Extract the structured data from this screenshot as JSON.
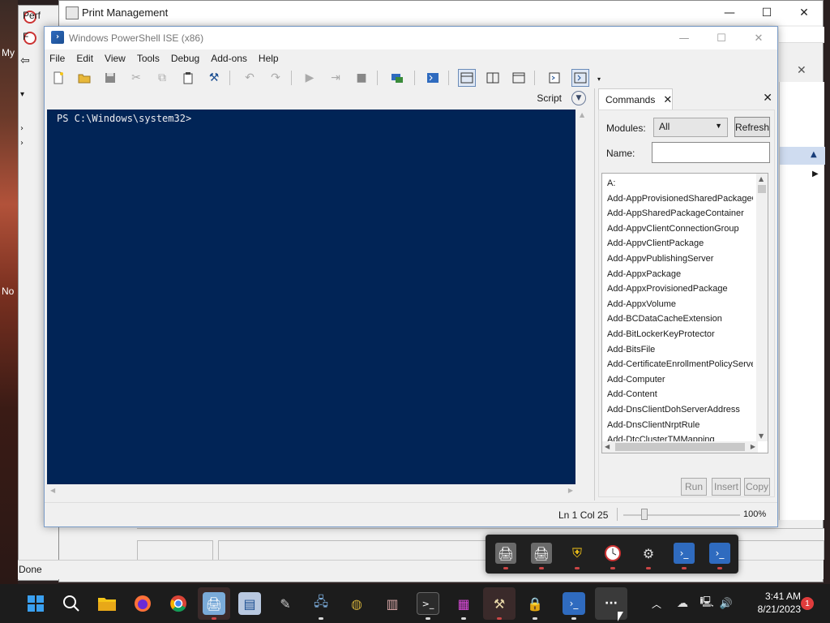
{
  "desktop": {
    "label_my": "My",
    "label_no": "No"
  },
  "perf_window": {
    "title": "Perf",
    "title2": "F"
  },
  "print_mgmt": {
    "title": "Print Management",
    "status": "Done",
    "controls": {
      "minimize": "—",
      "maximize": "☐",
      "close": "✕"
    }
  },
  "ise": {
    "title": "Windows PowerShell ISE (x86)",
    "controls": {
      "minimize": "—",
      "maximize": "☐",
      "close": "✕"
    },
    "menu": [
      "File",
      "Edit",
      "View",
      "Tools",
      "Debug",
      "Add-ons",
      "Help"
    ],
    "script_label": "Script",
    "console_prompt": "PS C:\\Windows\\system32>",
    "status_position": "Ln 1  Col 25",
    "zoom_percent": "100%",
    "zoom_level": 0.6
  },
  "commands": {
    "tab_label": "Commands",
    "modules_label": "Modules:",
    "modules_value": "All",
    "refresh_label": "Refresh",
    "name_label": "Name:",
    "items": [
      "A:",
      "Add-AppProvisionedSharedPackageC",
      "Add-AppSharedPackageContainer",
      "Add-AppvClientConnectionGroup",
      "Add-AppvClientPackage",
      "Add-AppvPublishingServer",
      "Add-AppxPackage",
      "Add-AppxProvisionedPackage",
      "Add-AppxVolume",
      "Add-BCDataCacheExtension",
      "Add-BitLockerKeyProtector",
      "Add-BitsFile",
      "Add-CertificateEnrollmentPolicyServe",
      "Add-Computer",
      "Add-Content",
      "Add-DnsClientDohServerAddress",
      "Add-DnsClientNrptRule",
      "Add-DtcClusterTMMapping"
    ],
    "run_label": "Run",
    "insert_label": "Insert",
    "copy_label": "Copy"
  },
  "taskbar": {
    "time": "3:41 AM",
    "date": "8/21/2023",
    "notification_count": "1",
    "overflow_label": "···"
  },
  "colors": {
    "console_bg": "#012456",
    "console_fg": "#eeedf0",
    "taskbar_bg": "#1c1c1c"
  }
}
